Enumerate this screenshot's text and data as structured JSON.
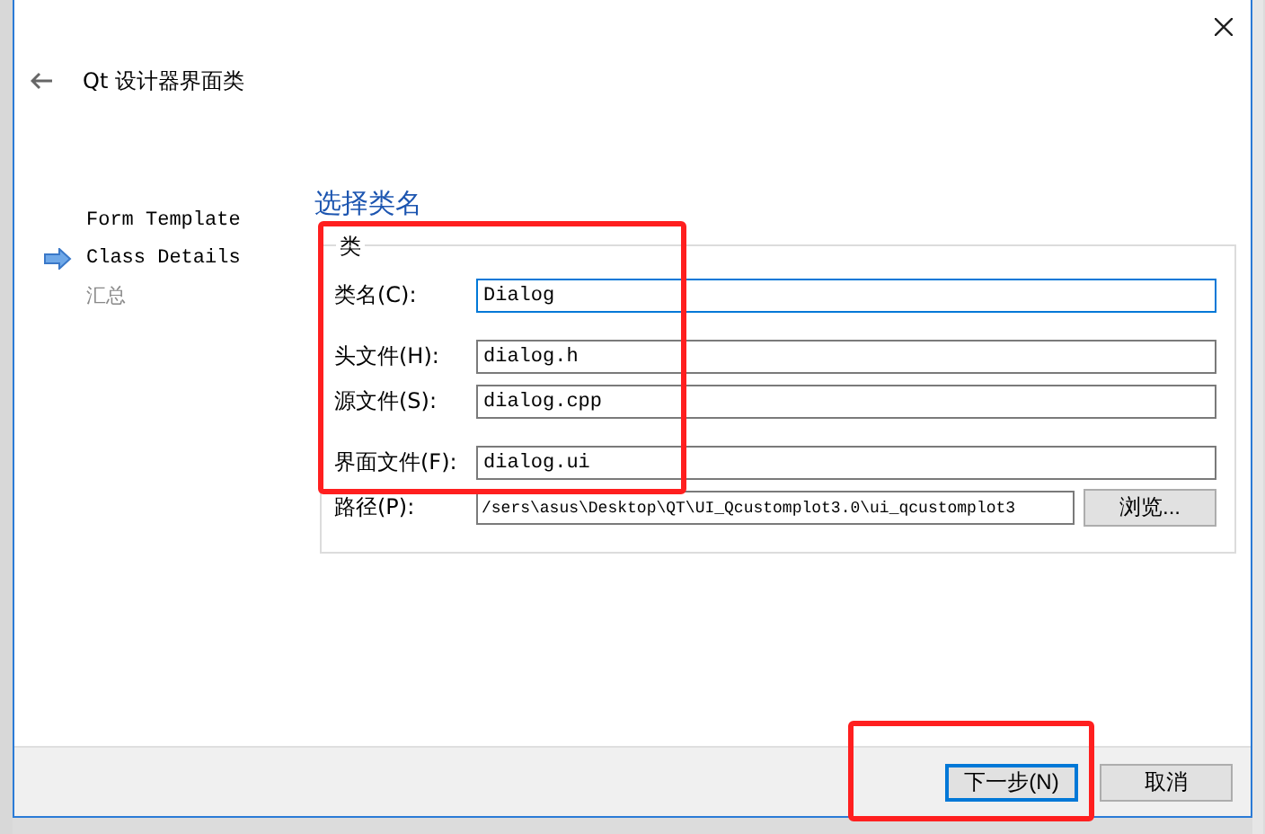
{
  "window": {
    "title": "Qt 设计器界面类"
  },
  "sidebar": {
    "items": [
      {
        "label": "Form Template",
        "selected": false,
        "done": true
      },
      {
        "label": "Class Details",
        "selected": true,
        "done": true
      },
      {
        "label": "汇总",
        "selected": false,
        "done": false
      }
    ]
  },
  "page": {
    "heading": "选择类名",
    "group": {
      "title": "类",
      "fields": [
        {
          "label": "类名(C):",
          "value": "Dialog",
          "focused": true
        },
        {
          "label": "头文件(H):",
          "value": "dialog.h",
          "focused": false
        },
        {
          "label": "源文件(S):",
          "value": "dialog.cpp",
          "focused": false
        },
        {
          "label": "界面文件(F):",
          "value": "dialog.ui",
          "focused": false
        },
        {
          "label": "路径(P):",
          "value": "/sers\\asus\\Desktop\\QT\\UI_Qcustomplot3.0\\ui_qcustomplot3",
          "focused": false,
          "browse": "浏览..."
        }
      ]
    }
  },
  "buttons": [
    {
      "label": "下一步(N)",
      "default": true
    },
    {
      "label": "取消",
      "default": false
    }
  ]
}
